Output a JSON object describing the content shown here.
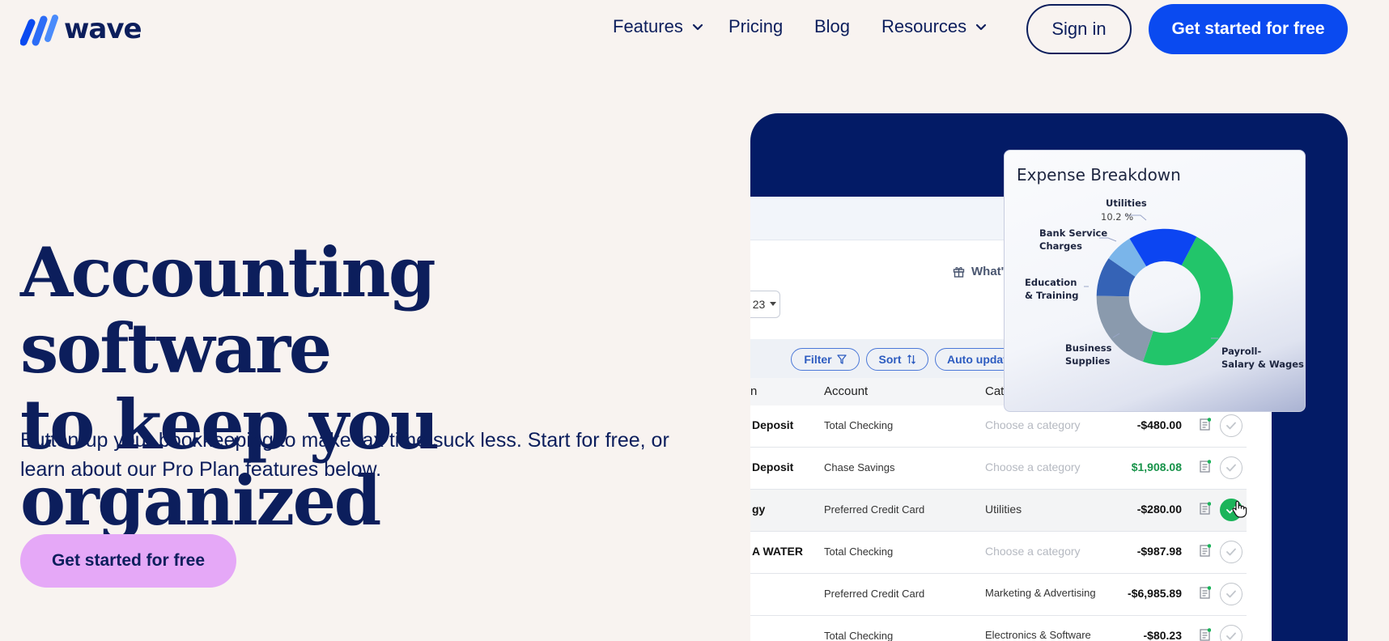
{
  "brand": {
    "name": "wave"
  },
  "nav": {
    "features": "Features",
    "pricing": "Pricing",
    "blog": "Blog",
    "resources": "Resources",
    "sign_in": "Sign in",
    "cta": "Get started for free"
  },
  "hero": {
    "title_line1": "Accounting software",
    "title_line2": "to keep you organized",
    "subtitle": "Button-up your bookkeeping to make tax time suck less. Start for free, or learn about our Pro Plan features below.",
    "cta": "Get started for free"
  },
  "app": {
    "whats_new": "What'",
    "date_value": "23",
    "filter": "Filter",
    "sort": "Sort",
    "auto_update": "Auto updat",
    "columns": {
      "desc": "n",
      "account": "Account",
      "category": "Cat"
    },
    "rows": [
      {
        "desc": "Deposit",
        "account": "Total Checking",
        "category": "Choose a category",
        "category_set": false,
        "amount": "-$480.00",
        "positive": false,
        "checked": false
      },
      {
        "desc": "Deposit",
        "account": "Chase Savings",
        "category": "Choose a category",
        "category_set": false,
        "amount": "$1,908.08",
        "positive": true,
        "checked": false
      },
      {
        "desc": "gy",
        "account": "Preferred Credit Card",
        "category": "Utilities",
        "category_set": true,
        "amount": "-$280.00",
        "positive": false,
        "checked": true
      },
      {
        "desc": "A WATER",
        "account": "Total Checking",
        "category": "Choose a category",
        "category_set": false,
        "amount": "-$987.98",
        "positive": false,
        "checked": false
      },
      {
        "desc": "",
        "account": "Preferred Credit Card",
        "category": "Marketing & Advertising",
        "category_set": true,
        "amount": "-$6,985.89",
        "positive": false,
        "checked": false
      },
      {
        "desc": "",
        "account": "Total Checking",
        "category": "Electronics & Software",
        "category_set": true,
        "amount": "-$80.23",
        "positive": false,
        "checked": false
      }
    ]
  },
  "expense": {
    "title": "Expense Breakdown",
    "utilities": "Utilities",
    "utilities_pct": "10.2 %",
    "bank_line1": "Bank Service",
    "bank_line2": "Charges",
    "edu_line1": "Education",
    "edu_line2": "& Training",
    "supplies_line1": "Business",
    "supplies_line2": "Supplies",
    "payroll_line1": "Payroll-",
    "payroll_line2": "Salary & Wages"
  },
  "colors": {
    "navy": "#0c1e5c",
    "brand_blue": "#0a4af0",
    "hero_cta": "#e5a8f7",
    "panel": "#031b66",
    "payroll": "#22c56a",
    "utilities": "#0c45f2",
    "bank": "#7ab5ea",
    "education": "#3563b6",
    "supplies": "#8a9aad"
  }
}
